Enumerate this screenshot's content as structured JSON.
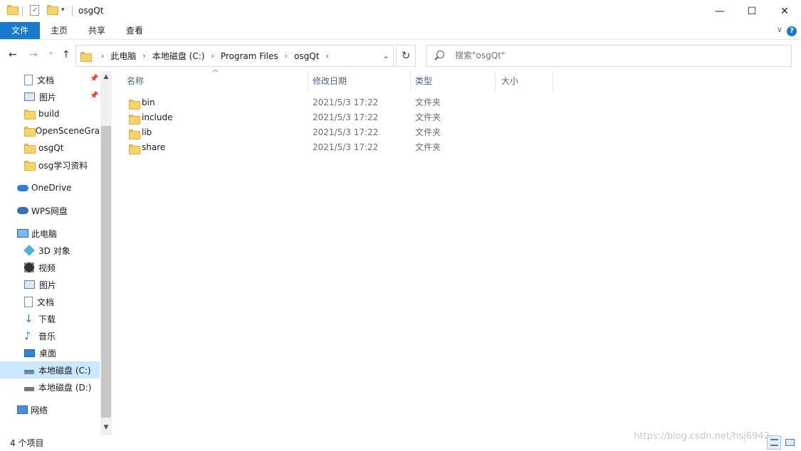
{
  "window": {
    "title": "osgQt",
    "minimize_glyph": "—",
    "maximize_glyph": "☐",
    "close_glyph": "✕"
  },
  "ribbon": {
    "tabs": [
      "文件",
      "主页",
      "共享",
      "查看"
    ],
    "help_glyph": "?",
    "expand_glyph": "∨"
  },
  "nav": {
    "back_glyph": "←",
    "forward_glyph": "→",
    "recent_glyph": "⌄",
    "up_glyph": "↑",
    "breadcrumb": [
      "此电脑",
      "本地磁盘 (C:)",
      "Program Files",
      "osgQt"
    ],
    "crumb_separator": "›",
    "dropdown_glyph": "⌄",
    "refresh_glyph": "↻",
    "search_placeholder": "搜索\"osgQt\""
  },
  "sidebar": {
    "pin_glyph": "📌",
    "quick_access": [
      {
        "label": "文档",
        "icon": "document-icon",
        "pinned": true
      },
      {
        "label": "图片",
        "icon": "picture-icon",
        "pinned": true
      },
      {
        "label": "build",
        "icon": "folder-icon",
        "pinned": false
      },
      {
        "label": "OpenSceneGra",
        "icon": "folder-icon",
        "pinned": false
      },
      {
        "label": "osgQt",
        "icon": "folder-icon",
        "pinned": false
      },
      {
        "label": "osg学习资料",
        "icon": "folder-icon",
        "pinned": false
      }
    ],
    "onedrive": "OneDrive",
    "wps": "WPS网盘",
    "this_pc": "此电脑",
    "pc_items": [
      {
        "label": "3D 对象",
        "icon": "3d-objects-icon"
      },
      {
        "label": "视频",
        "icon": "video-icon"
      },
      {
        "label": "图片",
        "icon": "picture-icon"
      },
      {
        "label": "文档",
        "icon": "document-icon"
      },
      {
        "label": "下载",
        "icon": "download-icon"
      },
      {
        "label": "音乐",
        "icon": "music-icon"
      },
      {
        "label": "桌面",
        "icon": "desktop-icon"
      },
      {
        "label": "本地磁盘 (C:)",
        "icon": "drive-c-icon",
        "selected": true
      },
      {
        "label": "本地磁盘 (D:)",
        "icon": "drive-d-icon"
      }
    ],
    "network": "网络",
    "scroll_up_glyph": "▲",
    "scroll_down_glyph": "▼"
  },
  "filelist": {
    "columns": [
      "名称",
      "修改日期",
      "类型",
      "大小"
    ],
    "sort_glyph": "^",
    "rows": [
      {
        "name": "bin",
        "date": "2021/5/3 17:22",
        "type": "文件夹",
        "size": ""
      },
      {
        "name": "include",
        "date": "2021/5/3 17:22",
        "type": "文件夹",
        "size": ""
      },
      {
        "name": "lib",
        "date": "2021/5/3 17:22",
        "type": "文件夹",
        "size": ""
      },
      {
        "name": "share",
        "date": "2021/5/3 17:22",
        "type": "文件夹",
        "size": ""
      }
    ]
  },
  "status": {
    "item_count": "4 个项目",
    "watermark": "https://blog.csdn.net/hsj6942"
  },
  "colors": {
    "accent": "#1979ca",
    "selection": "#cce8ff",
    "folder": "#f7d36b"
  }
}
